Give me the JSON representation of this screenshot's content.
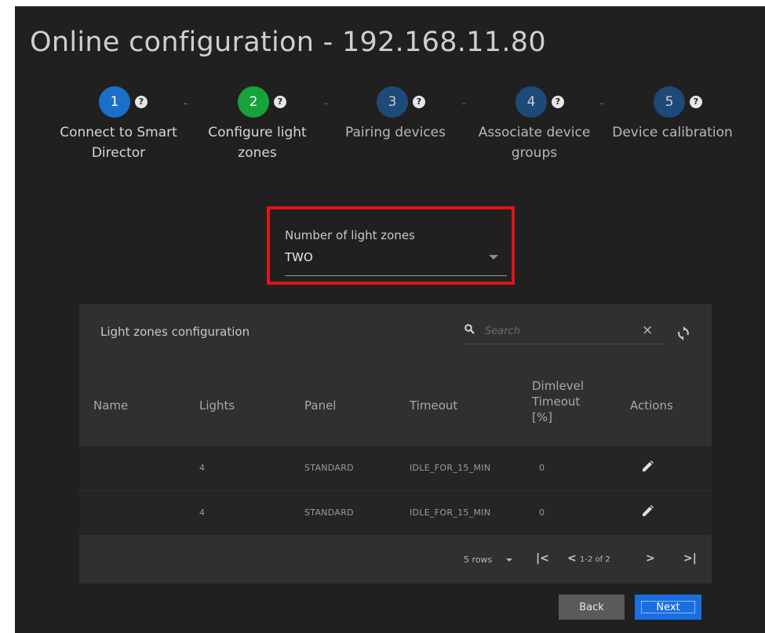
{
  "page": {
    "title": "Online configuration - 192.168.11.80"
  },
  "steps": [
    {
      "number": "1",
      "label": "Connect to Smart Director",
      "state": "active"
    },
    {
      "number": "2",
      "label": "Configure light zones",
      "state": "done"
    },
    {
      "number": "3",
      "label": "Pairing devices",
      "state": "pending"
    },
    {
      "number": "4",
      "label": "Associate device groups",
      "state": "pending"
    },
    {
      "number": "5",
      "label": "Device calibration",
      "state": "pending"
    }
  ],
  "step_separator": "-",
  "help_glyph": "?",
  "zones_select": {
    "label": "Number of light zones",
    "value": "TWO"
  },
  "table": {
    "title": "Light zones configuration",
    "search": {
      "placeholder": "Search",
      "value": ""
    },
    "clear_glyph": "×",
    "columns": {
      "name": "Name",
      "lights": "Lights",
      "panel": "Panel",
      "timeout": "Timeout",
      "dimlevel": "Dimlevel Timeout [%]",
      "actions": "Actions"
    },
    "rows": [
      {
        "name": "",
        "lights": "4",
        "panel": "STANDARD",
        "timeout": "IDLE_FOR_15_MIN",
        "dimlevel": "0"
      },
      {
        "name": "",
        "lights": "4",
        "panel": "STANDARD",
        "timeout": "IDLE_FOR_15_MIN",
        "dimlevel": "0"
      }
    ],
    "pagination": {
      "rows_per_page": "5 rows",
      "first": "|<",
      "prev": "<",
      "range": "1-2 of 2",
      "next": ">",
      "last": ">|"
    }
  },
  "buttons": {
    "back": "Back",
    "next": "Next"
  },
  "colors": {
    "step_active": "#1a6fc9",
    "step_done": "#17a23a",
    "step_pending": "#1d4a78",
    "highlight_border": "#e0141a",
    "primary_button": "#1a6fe0"
  }
}
